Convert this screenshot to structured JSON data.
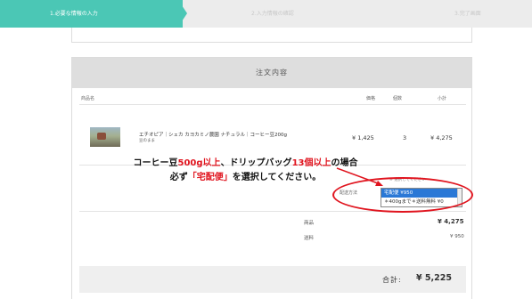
{
  "steps": [
    {
      "label": "1.必要な情報の入力"
    },
    {
      "label": "2.入力情報の確認"
    },
    {
      "label": "3.完了画面"
    }
  ],
  "panel": {
    "title": "注文内容",
    "headers": {
      "name": "商品名",
      "price": "価格",
      "qty": "個数",
      "subtotal": "小計"
    }
  },
  "product": {
    "name": "エチオピア｜シェカ カヨカミノ農園 ナチュラル｜コーヒー豆200g",
    "note": "豆のまま",
    "price": "¥ 1,425",
    "qty": "3",
    "subtotal": "¥ 4,275"
  },
  "shipping": {
    "note": "※ 選択してください",
    "label": "配送方法",
    "options": [
      "宅配便 ¥950",
      "＊400gまで＊送料無料 ¥0"
    ]
  },
  "summary": {
    "items_label": "商品",
    "items_value": "¥ 4,275",
    "shipping_label": "送料",
    "shipping_value": "¥ 950",
    "total_label": "合計:",
    "total_value": "¥ 5,225"
  },
  "callout": {
    "line1_a": "コーヒー豆",
    "line1_b": "500g以上",
    "line1_c": "、ドリップバッグ",
    "line1_d": "13個以上",
    "line1_e": "の場合",
    "line2_a": "必ず",
    "line2_b": "「宅配便」",
    "line2_c": "を選択してください。"
  },
  "colors": {
    "accent": "#4bc7b5",
    "highlight": "#e0141e",
    "select": "#2a78d6"
  }
}
